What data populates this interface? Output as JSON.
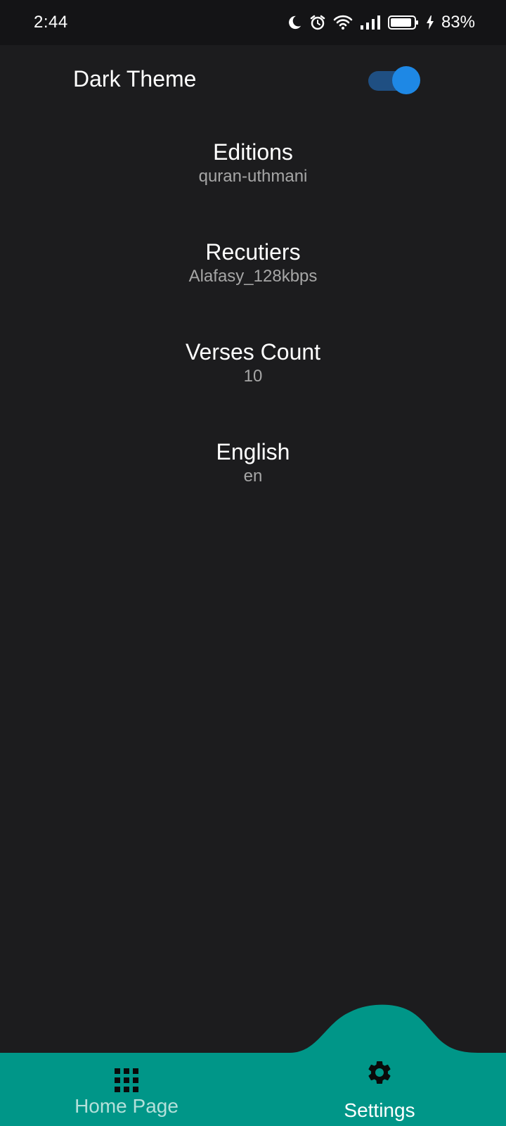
{
  "status_bar": {
    "time": "2:44",
    "battery_percent": "83%",
    "icons": [
      "moon-icon",
      "alarm-icon",
      "wifi-icon",
      "signal-icon",
      "battery-icon",
      "charging-bolt-icon"
    ]
  },
  "theme": {
    "label": "Dark Theme",
    "enabled": true
  },
  "settings": {
    "editions": {
      "title": "Editions",
      "value": "quran-uthmani"
    },
    "reciters": {
      "title": "Recutiers",
      "value": "Alafasy_128kbps"
    },
    "verses_count": {
      "title": "Verses Count",
      "value": "10"
    },
    "language": {
      "title": "English",
      "value": "en"
    }
  },
  "bottom_nav": {
    "home": {
      "label": "Home Page",
      "icon": "grid-icon"
    },
    "settings": {
      "label": "Settings",
      "icon": "gear-icon",
      "active": true
    }
  },
  "colors": {
    "background": "#1c1c1e",
    "status_bar": "#141416",
    "nav_accent": "#009688",
    "toggle_thumb": "#1e88e5",
    "toggle_track": "#1f4f82",
    "secondary_text": "#a6a6a6"
  }
}
